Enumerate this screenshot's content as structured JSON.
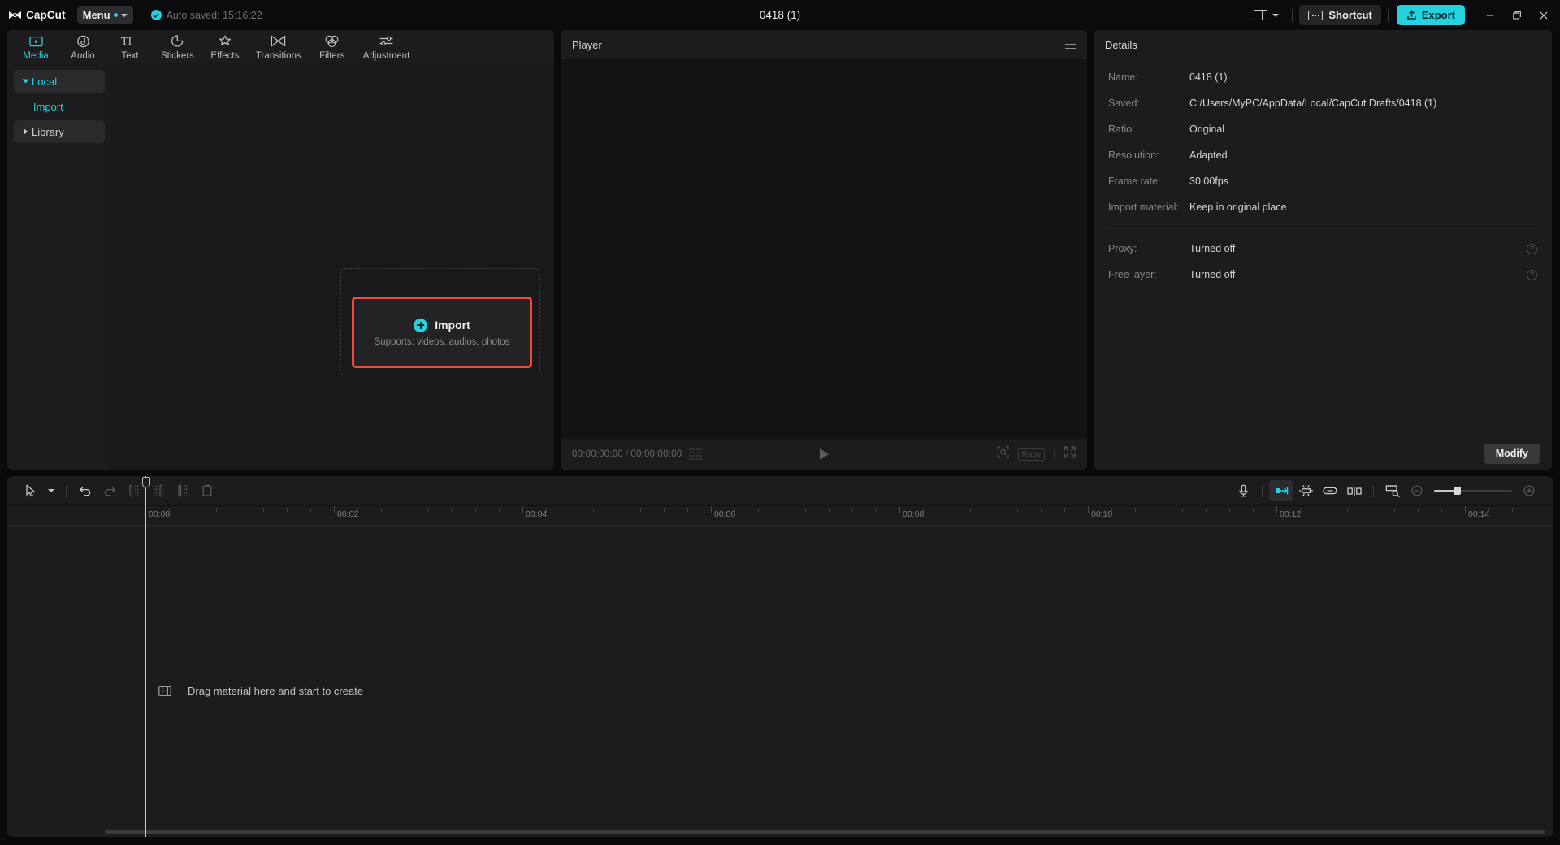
{
  "app": {
    "brand": "CapCut",
    "menu_label": "Menu",
    "autosave": "Auto saved: 15:16:22",
    "document_title": "0418 (1)",
    "shortcut_label": "Shortcut",
    "export_label": "Export",
    "accent": "#22d2de",
    "highlight": "#f6483a"
  },
  "tabs": [
    {
      "label": "Media",
      "icon": "media-icon",
      "active": true
    },
    {
      "label": "Audio",
      "icon": "audio-icon",
      "active": false
    },
    {
      "label": "Text",
      "icon": "text-icon",
      "active": false
    },
    {
      "label": "Stickers",
      "icon": "stickers-icon",
      "active": false
    },
    {
      "label": "Effects",
      "icon": "effects-icon",
      "active": false
    },
    {
      "label": "Transitions",
      "icon": "transitions-icon",
      "active": false
    },
    {
      "label": "Filters",
      "icon": "filters-icon",
      "active": false
    },
    {
      "label": "Adjustment",
      "icon": "adjustment-icon",
      "active": false
    }
  ],
  "sidenav": {
    "local": "Local",
    "import": "Import",
    "library": "Library"
  },
  "media": {
    "import_label": "Import",
    "import_support": "Supports: videos, audios, photos"
  },
  "player": {
    "title": "Player",
    "current_time": "00:00:00:00",
    "total_time": "00:00:00:00",
    "ratio_label": "Ratio"
  },
  "details": {
    "title": "Details",
    "rows": [
      {
        "label": "Name:",
        "value": "0418 (1)"
      },
      {
        "label": "Saved:",
        "value": "C:/Users/MyPC/AppData/Local/CapCut Drafts/0418 (1)"
      },
      {
        "label": "Ratio:",
        "value": "Original"
      },
      {
        "label": "Resolution:",
        "value": "Adapted"
      },
      {
        "label": "Frame rate:",
        "value": "30.00fps"
      },
      {
        "label": "Import material:",
        "value": "Keep in original place"
      }
    ],
    "toggles": [
      {
        "label": "Proxy:",
        "value": "Turned off",
        "help": "?"
      },
      {
        "label": "Free layer:",
        "value": "Turned off",
        "help": "?"
      }
    ],
    "modify_label": "Modify"
  },
  "timeline": {
    "placeholder": "Drag material here and start to create",
    "ruler_labels": [
      "00:00",
      "00:02",
      "00:04",
      "00:06",
      "00:08",
      "00:10",
      "00:12",
      "00:14"
    ],
    "tools": [
      {
        "name": "select-tool",
        "dim": false
      },
      {
        "name": "undo-tool",
        "dim": false
      },
      {
        "name": "redo-tool",
        "dim": true
      },
      {
        "name": "split-left",
        "dim": true
      },
      {
        "name": "split-right",
        "dim": true
      },
      {
        "name": "split-both",
        "dim": true
      },
      {
        "name": "delete-tool",
        "dim": true
      }
    ],
    "right_tools": [
      {
        "name": "record-audio",
        "active": false
      },
      {
        "name": "snap-magnet",
        "active": true
      },
      {
        "name": "auto-adsorb",
        "active": false
      },
      {
        "name": "link-clips",
        "active": false
      },
      {
        "name": "mirror-clip",
        "active": false
      },
      {
        "name": "preview-scale",
        "active": false
      }
    ]
  }
}
